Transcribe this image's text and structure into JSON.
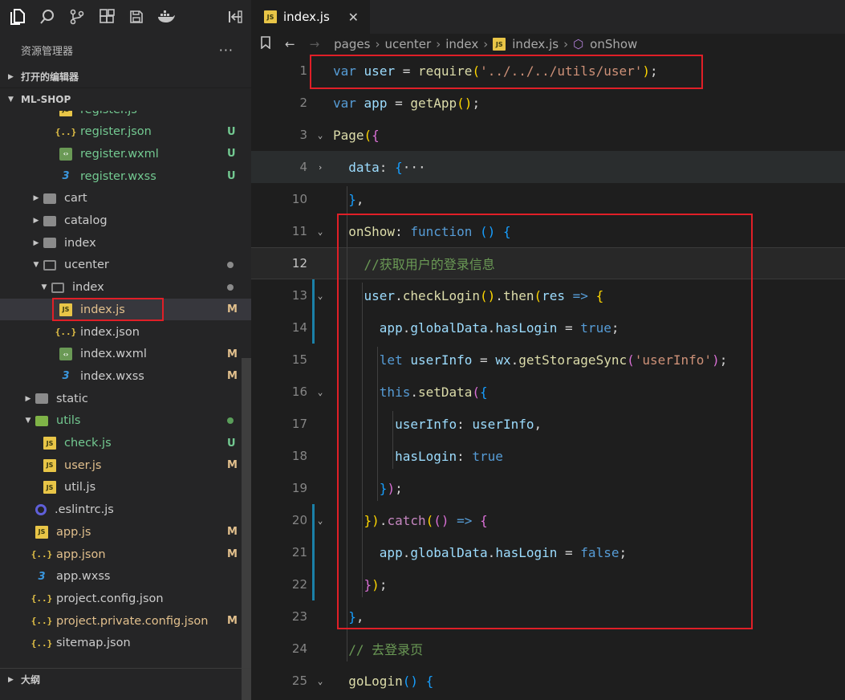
{
  "explorer": {
    "title": "资源管理器",
    "more": "···",
    "open_editors": "打开的编辑器",
    "project": "ML-SHOP",
    "outline": "大纲"
  },
  "tree": [
    {
      "label": "register.js",
      "icon": "js",
      "indent": 74,
      "color": "green",
      "badge": "",
      "partial": true
    },
    {
      "label": "register.json",
      "icon": "json",
      "indent": 74,
      "color": "green",
      "badge": "U"
    },
    {
      "label": "register.wxml",
      "icon": "wxml",
      "indent": 74,
      "color": "green",
      "badge": "U"
    },
    {
      "label": "register.wxss",
      "icon": "wxss",
      "indent": 74,
      "color": "green",
      "badge": "U"
    },
    {
      "label": "cart",
      "icon": "folder",
      "indent": 54,
      "twisty": "right",
      "color": "normal",
      "badge": ""
    },
    {
      "label": "catalog",
      "icon": "folder",
      "indent": 54,
      "twisty": "right",
      "color": "normal",
      "badge": ""
    },
    {
      "label": "index",
      "icon": "folder",
      "indent": 54,
      "twisty": "right",
      "color": "normal",
      "badge": ""
    },
    {
      "label": "ucenter",
      "icon": "folder-open",
      "indent": 54,
      "twisty": "down",
      "color": "normal",
      "badge": "dot"
    },
    {
      "label": "index",
      "icon": "folder-open",
      "indent": 64,
      "twisty": "down",
      "color": "normal",
      "badge": "dot"
    },
    {
      "label": "index.js",
      "icon": "js",
      "indent": 74,
      "color": "yellow",
      "badge": "M",
      "selected": true
    },
    {
      "label": "index.json",
      "icon": "json",
      "indent": 74,
      "color": "normal",
      "badge": ""
    },
    {
      "label": "index.wxml",
      "icon": "wxml",
      "indent": 74,
      "color": "normal",
      "badge": "M"
    },
    {
      "label": "index.wxss",
      "icon": "wxss",
      "indent": 74,
      "color": "normal",
      "badge": "M"
    },
    {
      "label": "static",
      "icon": "folder",
      "indent": 44,
      "twisty": "right",
      "color": "normal",
      "badge": ""
    },
    {
      "label": "utils",
      "icon": "folder-green",
      "indent": 44,
      "twisty": "down",
      "color": "green",
      "badge": "dot-green"
    },
    {
      "label": "check.js",
      "icon": "js",
      "indent": 54,
      "color": "green",
      "badge": "U"
    },
    {
      "label": "user.js",
      "icon": "js",
      "indent": 54,
      "color": "yellow",
      "badge": "M"
    },
    {
      "label": "util.js",
      "icon": "js",
      "indent": 54,
      "color": "normal",
      "badge": ""
    },
    {
      "label": ".eslintrc.js",
      "icon": "eslint",
      "indent": 44,
      "color": "normal",
      "badge": ""
    },
    {
      "label": "app.js",
      "icon": "js",
      "indent": 44,
      "color": "yellow",
      "badge": "M"
    },
    {
      "label": "app.json",
      "icon": "json",
      "indent": 44,
      "color": "yellow",
      "badge": "M"
    },
    {
      "label": "app.wxss",
      "icon": "wxss",
      "indent": 44,
      "color": "normal",
      "badge": ""
    },
    {
      "label": "project.config.json",
      "icon": "json",
      "indent": 44,
      "color": "normal",
      "badge": ""
    },
    {
      "label": "project.private.config.json",
      "icon": "json",
      "indent": 44,
      "color": "yellow",
      "badge": "M"
    },
    {
      "label": "sitemap.json",
      "icon": "json",
      "indent": 44,
      "color": "normal",
      "badge": ""
    }
  ],
  "tab": {
    "label": "index.js",
    "close": "✕"
  },
  "breadcrumb": [
    "pages",
    "ucenter",
    "index",
    "index.js",
    "onShow"
  ],
  "code_lines": [
    {
      "n": "1",
      "fold": "",
      "html": "<span class=\"k\">var</span> <span class=\"v\">user</span> <span class=\"t\">=</span> <span class=\"f\">require</span><span class=\"y\">(</span><span class=\"s\">'../../../utils/user'</span><span class=\"y\">)</span><span class=\"t\">;</span>"
    },
    {
      "n": "2",
      "fold": "",
      "html": "<span class=\"k\">var</span> <span class=\"v\">app</span> <span class=\"t\">=</span> <span class=\"f\">getApp</span><span class=\"y\">()</span><span class=\"t\">;</span>"
    },
    {
      "n": "3",
      "fold": "⌄",
      "html": "<span class=\"f\">Page</span><span class=\"y\">(</span><span class=\"p\">{</span>"
    },
    {
      "n": "4",
      "fold": "›",
      "html": "  <span class=\"v\">data</span><span class=\"t\">:</span> <span class=\"b\">{</span><span class=\"t\">···</span>"
    },
    {
      "n": "10",
      "fold": "",
      "html": "  <span class=\"b\">}</span><span class=\"t\">,</span>"
    },
    {
      "n": "11",
      "fold": "⌄",
      "html": "  <span class=\"f\">onShow</span><span class=\"t\">:</span> <span class=\"k\">function</span> <span class=\"b\">()</span> <span class=\"b\">{</span>"
    },
    {
      "n": "12",
      "fold": "",
      "html": "    <span class=\"c\">//获取用户的登录信息</span>"
    },
    {
      "n": "13",
      "fold": "⌄",
      "html": "    <span class=\"v\">user</span><span class=\"t\">.</span><span class=\"f\">checkLogin</span><span class=\"y\">()</span><span class=\"t\">.</span><span class=\"f\">then</span><span class=\"y\">(</span><span class=\"v\">res</span> <span class=\"k\">=&gt;</span> <span class=\"y\">{</span>"
    },
    {
      "n": "14",
      "fold": "",
      "html": "      <span class=\"v\">app</span><span class=\"t\">.</span><span class=\"v\">globalData</span><span class=\"t\">.</span><span class=\"v\">hasLogin</span> <span class=\"t\">=</span> <span class=\"k\">true</span><span class=\"t\">;</span>"
    },
    {
      "n": "15",
      "fold": "",
      "html": "      <span class=\"k\">let</span> <span class=\"v\">userInfo</span> <span class=\"t\">=</span> <span class=\"v\">wx</span><span class=\"t\">.</span><span class=\"f\">getStorageSync</span><span class=\"p\">(</span><span class=\"s\">'userInfo'</span><span class=\"p\">)</span><span class=\"t\">;</span>"
    },
    {
      "n": "16",
      "fold": "⌄",
      "html": "      <span class=\"k\">this</span><span class=\"t\">.</span><span class=\"f\">setData</span><span class=\"p\">(</span><span class=\"b\">{</span>"
    },
    {
      "n": "17",
      "fold": "",
      "html": "        <span class=\"v\">userInfo</span><span class=\"t\">:</span> <span class=\"v\">userInfo</span><span class=\"t\">,</span>"
    },
    {
      "n": "18",
      "fold": "",
      "html": "        <span class=\"v\">hasLogin</span><span class=\"t\">:</span> <span class=\"k\">true</span>"
    },
    {
      "n": "19",
      "fold": "",
      "html": "      <span class=\"b\">}</span><span class=\"p\">)</span><span class=\"t\">;</span>"
    },
    {
      "n": "20",
      "fold": "⌄",
      "html": "    <span class=\"y\">}</span><span class=\"y\">)</span><span class=\"t\">.</span><span class=\"kw\">catch</span><span class=\"y\">(</span><span class=\"p\">()</span> <span class=\"k\">=&gt;</span> <span class=\"p\">{</span>"
    },
    {
      "n": "21",
      "fold": "",
      "html": "      <span class=\"v\">app</span><span class=\"t\">.</span><span class=\"v\">globalData</span><span class=\"t\">.</span><span class=\"v\">hasLogin</span> <span class=\"t\">=</span> <span class=\"k\">false</span><span class=\"t\">;</span>"
    },
    {
      "n": "22",
      "fold": "",
      "html": "    <span class=\"p\">}</span><span class=\"y\">)</span><span class=\"t\">;</span>"
    },
    {
      "n": "23",
      "fold": "",
      "html": "  <span class=\"b\">}</span><span class=\"t\">,</span>"
    },
    {
      "n": "24",
      "fold": "",
      "html": "  <span class=\"c\">// 去登录页</span>"
    },
    {
      "n": "25",
      "fold": "⌄",
      "html": "  <span class=\"f\">goLogin</span><span class=\"b\">()</span> <span class=\"b\">{</span>"
    }
  ],
  "code_text": [
    "var user = require('../../../utils/user');",
    "var app = getApp();",
    "Page({",
    "data: {···",
    "},",
    "onShow: function () {",
    "//获取用户的登录信息",
    "user.checkLogin().then(res => {",
    "app.globalData.hasLogin = true;",
    "let userInfo = wx.getStorageSync('userInfo');",
    "this.setData({",
    "userInfo: userInfo,",
    "hasLogin: true",
    "});",
    "}).catch(() => {",
    "app.globalData.hasLogin = false;",
    "});",
    "},",
    "// 去登录页",
    "goLogin() {"
  ]
}
